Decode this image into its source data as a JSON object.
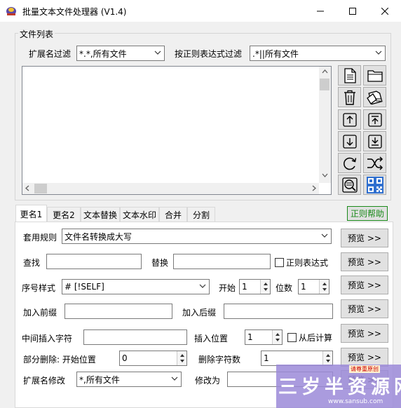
{
  "window": {
    "title": "批量文本文件处理器 (V1.4)"
  },
  "file_group": {
    "label": "文件列表",
    "ext_filter_label": "扩展名过滤",
    "ext_filter_value": "*.*,所有文件",
    "regex_filter_label": "按正则表达式过滤",
    "regex_filter_value": ".*||所有文件"
  },
  "tabs": [
    "更名1",
    "更名2",
    "文本替换",
    "文本水印",
    "合并",
    "分割"
  ],
  "regex_help_button": "正则帮助",
  "rename1": {
    "rule_label": "套用规则",
    "rule_value": "文件名转换成大写",
    "find_label": "查找",
    "find_value": "",
    "replace_label": "替换",
    "replace_value": "",
    "regex_checkbox_label": "正则表达式",
    "seq_style_label": "序号样式",
    "seq_style_value": "# [!SELF]",
    "start_label": "开始",
    "start_value": "1",
    "digits_label": "位数",
    "digits_value": "1",
    "prefix_label": "加入前缀",
    "prefix_value": "",
    "suffix_label": "加入后缀",
    "suffix_value": "",
    "insert_label": "中间插入字符",
    "insert_value": "",
    "insert_pos_label": "插入位置",
    "insert_pos_value": "1",
    "from_end_label": "从后计算",
    "partial_delete_label": "部分删除: 开始位置",
    "partial_delete_start_value": "0",
    "delete_count_label": "删除字符数",
    "delete_count_value": "1",
    "ext_modify_label": "扩展名修改",
    "ext_modify_value": "*,所有文件",
    "modify_to_label": "修改为",
    "modify_to_value": "",
    "preview_label": "预览 >>"
  },
  "watermark": {
    "text": "三岁半资源网",
    "url": "www.sansub.com",
    "stamp": "请尊重原创"
  },
  "colors": {
    "regex_help": "#1a8a1a",
    "accent_blue": "#2f6fcf"
  }
}
